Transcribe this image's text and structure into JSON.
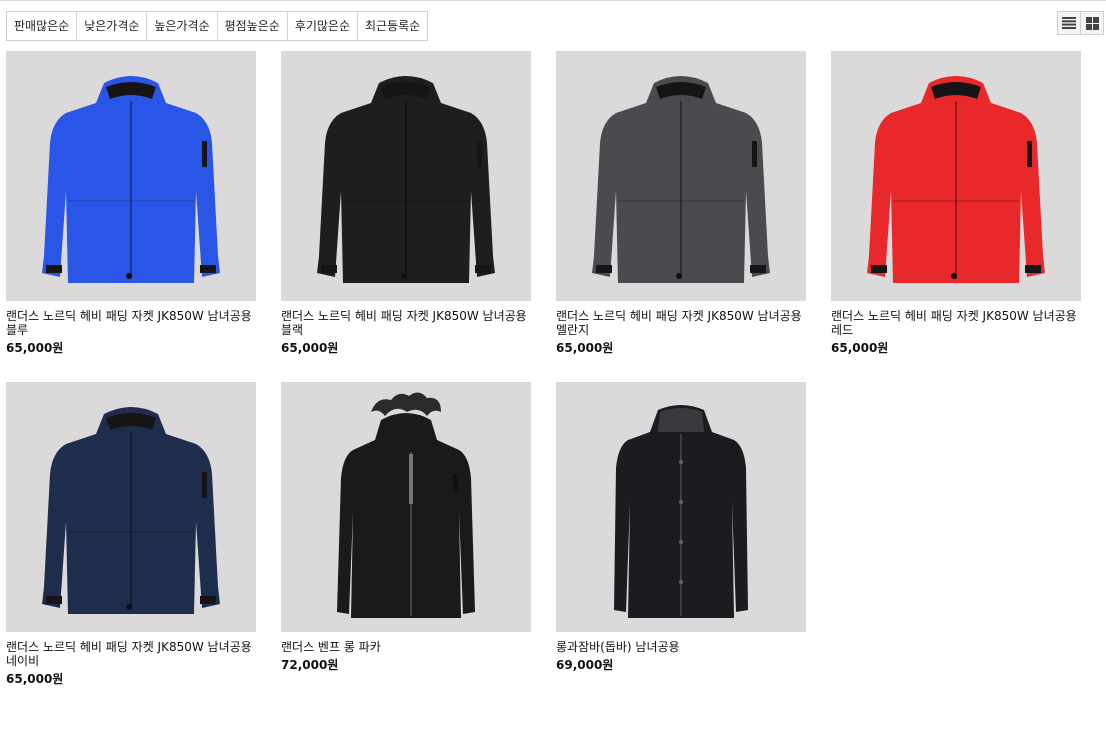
{
  "sort_options": [
    "판매많은순",
    "낮은가격순",
    "높은가격순",
    "평점높은순",
    "후기많은순",
    "최근등록순"
  ],
  "view_toggle": {
    "list_icon": "list-view-icon",
    "grid_icon": "grid-view-icon"
  },
  "products": [
    {
      "name": "랜더스 노르딕 헤비 패딩 자켓 JK850W 남녀공용 블루",
      "price": "65,000원",
      "color": "#2a56e8",
      "style": "jacket"
    },
    {
      "name": "랜더스 노르딕 헤비 패딩 자켓 JK850W 남녀공용 블랙",
      "price": "65,000원",
      "color": "#1e1e1e",
      "style": "jacket"
    },
    {
      "name": "랜더스 노르딕 헤비 패딩 자켓 JK850W 남녀공용 멜란지",
      "price": "65,000원",
      "color": "#4a4b4f",
      "style": "jacket"
    },
    {
      "name": "랜더스 노르딕 헤비 패딩 자켓 JK850W 남녀공용 레드",
      "price": "65,000원",
      "color": "#e8282a",
      "style": "jacket"
    },
    {
      "name": "랜더스 노르딕 헤비 패딩 자켓 JK850W 남녀공용 네이비",
      "price": "65,000원",
      "color": "#1f2d4d",
      "style": "jacket"
    },
    {
      "name": "랜더스 벤프 롱 파카",
      "price": "72,000원",
      "color": "#1a1a1c",
      "style": "long-fur"
    },
    {
      "name": "롱과잠바(돕바) 남녀공용",
      "price": "69,000원",
      "color": "#1b1c20",
      "style": "long"
    }
  ]
}
